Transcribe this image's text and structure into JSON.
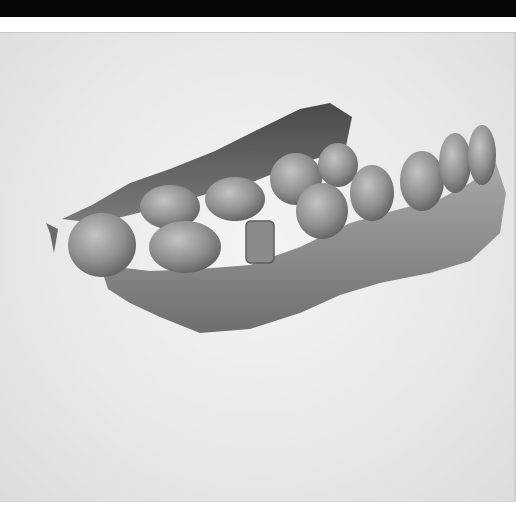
{
  "app": {
    "title_bar_color": "#050505",
    "viewport_background": "#e9e9e9"
  },
  "viewport": {
    "model": {
      "name": "dental-arch-scan-mesh",
      "mesh_color": "#8e8e8e"
    }
  }
}
